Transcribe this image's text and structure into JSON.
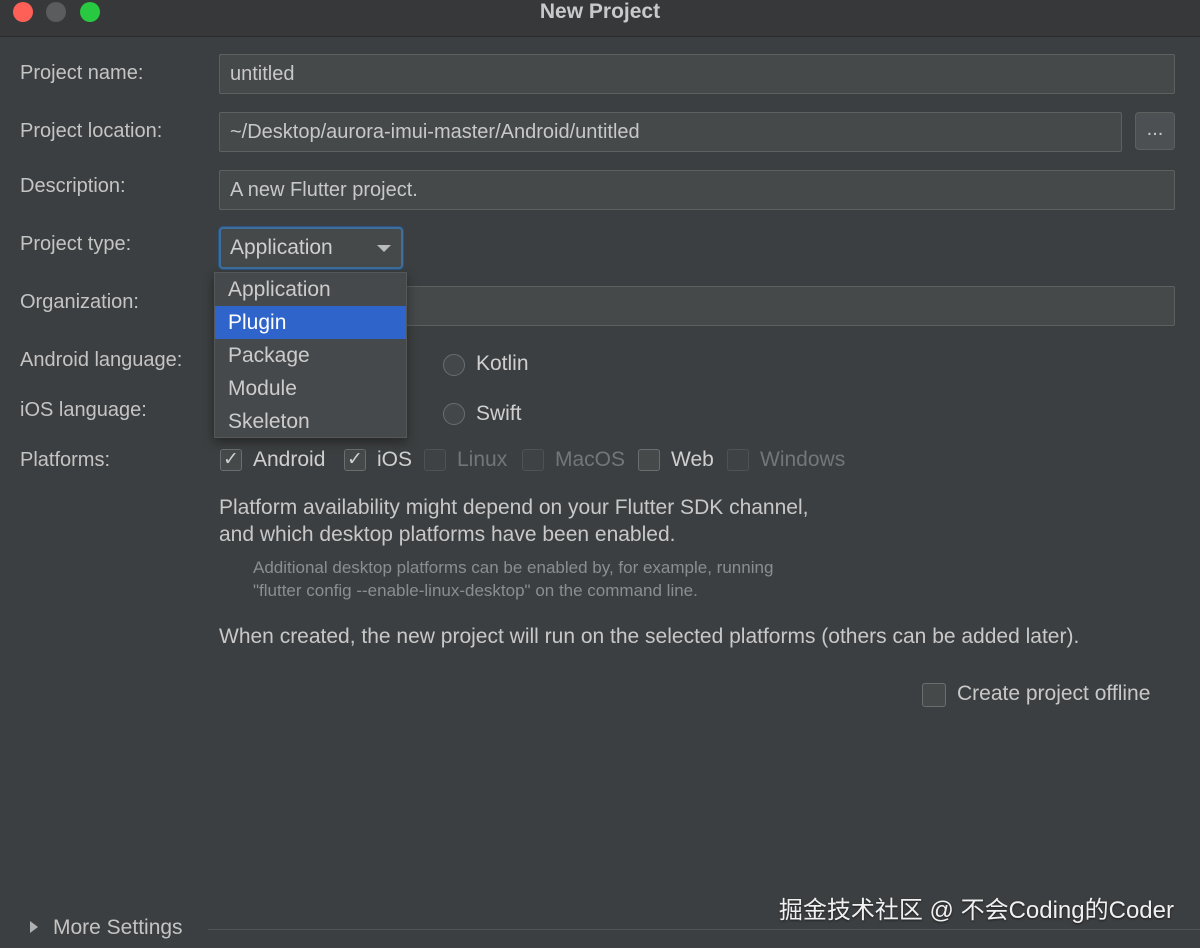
{
  "window": {
    "title": "New Project"
  },
  "form": {
    "project_name_label": "Project name:",
    "project_name_value": "untitled",
    "project_location_label": "Project location:",
    "project_location_value": "~/Desktop/aurora-imui-master/Android/untitled",
    "browse_label": "...",
    "description_label": "Description:",
    "description_value": "A new Flutter project.",
    "project_type_label": "Project type:",
    "project_type_value": "Application",
    "organization_label": "Organization:",
    "organization_value": "",
    "android_language_label": "Android language:",
    "android_language_option": "Kotlin",
    "ios_language_label": "iOS language:",
    "ios_language_option": "Swift",
    "platforms_label": "Platforms:"
  },
  "dropdown": {
    "options": [
      "Application",
      "Plugin",
      "Package",
      "Module",
      "Skeleton"
    ],
    "highlighted": "Plugin"
  },
  "platforms": [
    {
      "label": "Android",
      "checked": true,
      "enabled": true
    },
    {
      "label": "iOS",
      "checked": true,
      "enabled": true
    },
    {
      "label": "Linux",
      "checked": false,
      "enabled": false
    },
    {
      "label": "MacOS",
      "checked": false,
      "enabled": false
    },
    {
      "label": "Web",
      "checked": false,
      "enabled": true
    },
    {
      "label": "Windows",
      "checked": false,
      "enabled": false
    }
  ],
  "info": {
    "availability_line1": "Platform availability might depend on your Flutter SDK channel,",
    "availability_line2": "and which desktop platforms have been enabled.",
    "hint_line1": "Additional desktop platforms can be enabled by, for example, running",
    "hint_line2": "\"flutter config --enable-linux-desktop\" on the command line.",
    "created_note": "When created, the new project will run on the selected platforms (others can be added later)."
  },
  "offline": {
    "label": "Create project offline",
    "checked": false
  },
  "more_settings": {
    "label": "More Settings"
  },
  "watermark": "掘金技术社区 @ 不会Coding的Coder",
  "colors": {
    "background": "#3c3f41",
    "selection": "#2f65ca",
    "focus_border": "#3e6f9c"
  }
}
